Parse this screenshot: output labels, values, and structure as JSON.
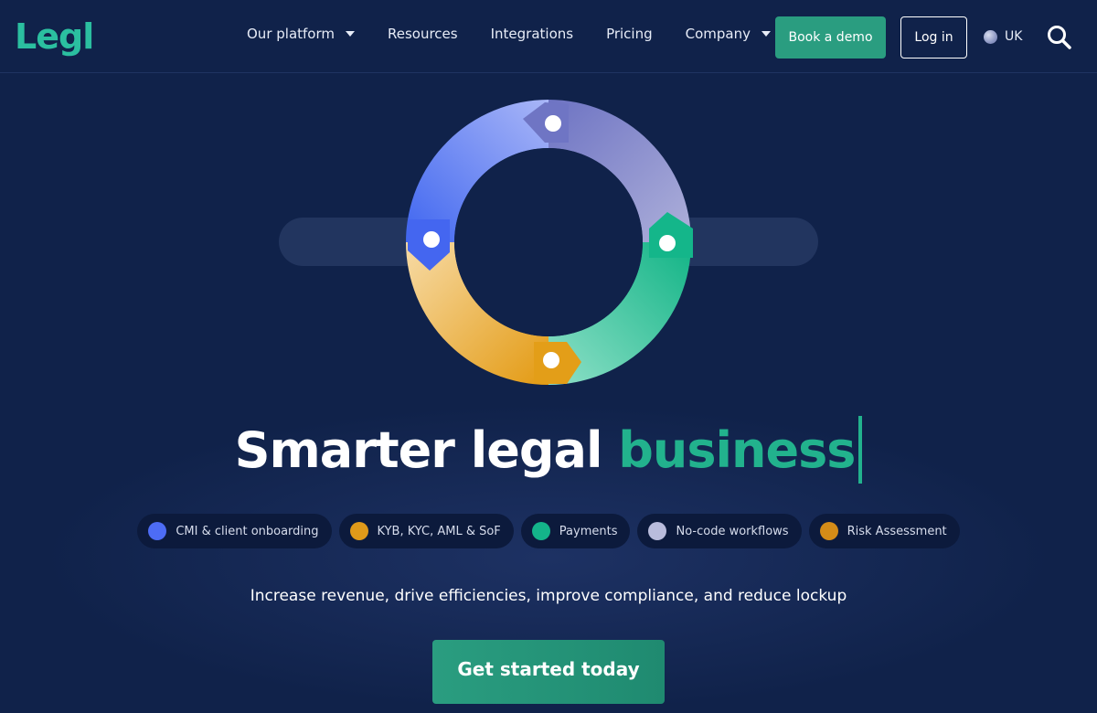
{
  "brand": {
    "logo_text": "Legl",
    "logo_color": "#2bbfa0"
  },
  "nav": {
    "items": [
      {
        "label": "Our platform",
        "has_dropdown": true
      },
      {
        "label": "Resources",
        "has_dropdown": false
      },
      {
        "label": "Integrations",
        "has_dropdown": false
      },
      {
        "label": "Pricing",
        "has_dropdown": false
      },
      {
        "label": "Company",
        "has_dropdown": true
      }
    ],
    "book_demo_label": "Book a demo",
    "login_label": "Log in",
    "locale_label": "UK",
    "search_icon": "search-icon",
    "globe_icon": "globe-icon"
  },
  "hero": {
    "headline_main": "Smarter legal ",
    "headline_accent": "business",
    "subtext": "Increase revenue, drive efficiencies, improve compliance, and reduce lockup",
    "cta_label": "Get started today"
  },
  "features": [
    {
      "label": "CMI & client onboarding",
      "color": "#4d6cf5"
    },
    {
      "label": "KYB, KYC, AML & SoF",
      "color": "#e09a1a"
    },
    {
      "label": "Payments",
      "color": "#14b48a"
    },
    {
      "label": "No-code workflows",
      "color": "#b9bcdc"
    },
    {
      "label": "Risk Assessment",
      "color": "#d48c18"
    }
  ],
  "colors": {
    "background": "#10224a",
    "accent_green": "#22b28d",
    "button_green": "#2a9d80"
  }
}
